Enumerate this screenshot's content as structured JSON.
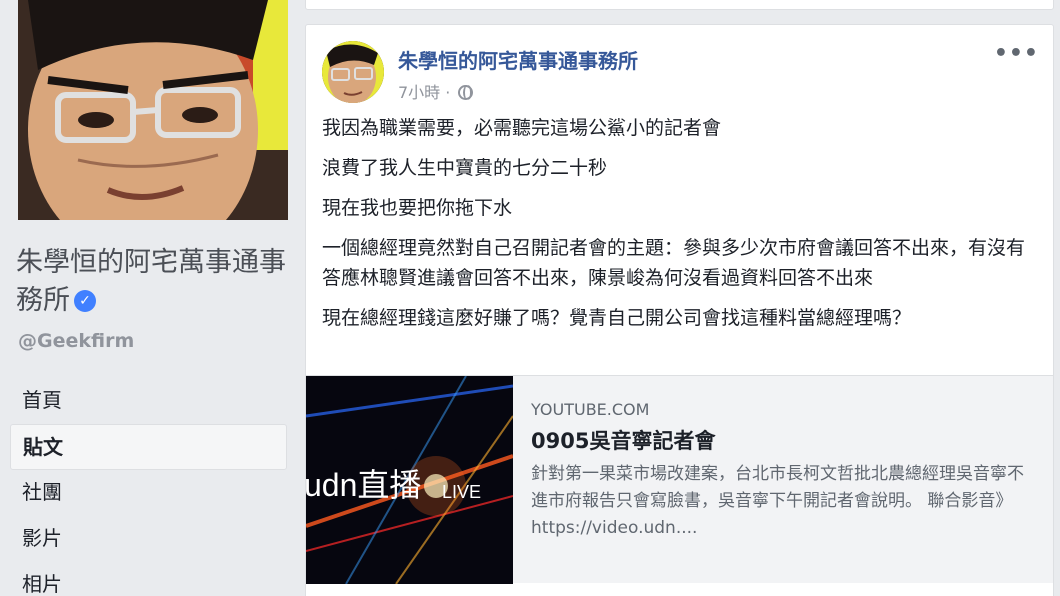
{
  "sidebar": {
    "page_name": "朱學恒的阿宅萬事通事務所",
    "handle": "@Geekfirm",
    "nav": [
      {
        "label": "首頁"
      },
      {
        "label": "貼文"
      },
      {
        "label": "社團"
      },
      {
        "label": "影片"
      },
      {
        "label": "相片"
      }
    ]
  },
  "post": {
    "author": "朱學恒的阿宅萬事通事務所",
    "time": "7小時 · ",
    "more": "•••",
    "paragraphs": [
      "我因為職業需要，必需聽完這場公鯊小的記者會",
      "浪費了我人生中寶貴的七分二十秒",
      "現在我也要把你拖下水",
      "一個總經理竟然對自己召開記者會的主題：參與多少次市府會議回答不出來，有沒有答應林聰賢進議會回答不出來，陳景峻為何沒看過資料回答不出來",
      "現在總經理錢這麼好賺了嗎？覺青自己開公司會找這種料當總經理嗎？"
    ],
    "link": {
      "domain": "YOUTUBE.COM",
      "title": "0905吳音寧記者會",
      "description": "針對第一果菜市場改建案，台北市長柯文哲批北農總經理吳音寧不進市府報告只會寫臉書，吳音寧下午開記者會說明。 聯合影音》https://video.udn....",
      "thumb_text": "udn直播",
      "thumb_badge": "LIVE"
    }
  },
  "colors": {
    "background": "#e9ebee",
    "link_blue": "#365899",
    "verified_blue": "#4080ff"
  }
}
